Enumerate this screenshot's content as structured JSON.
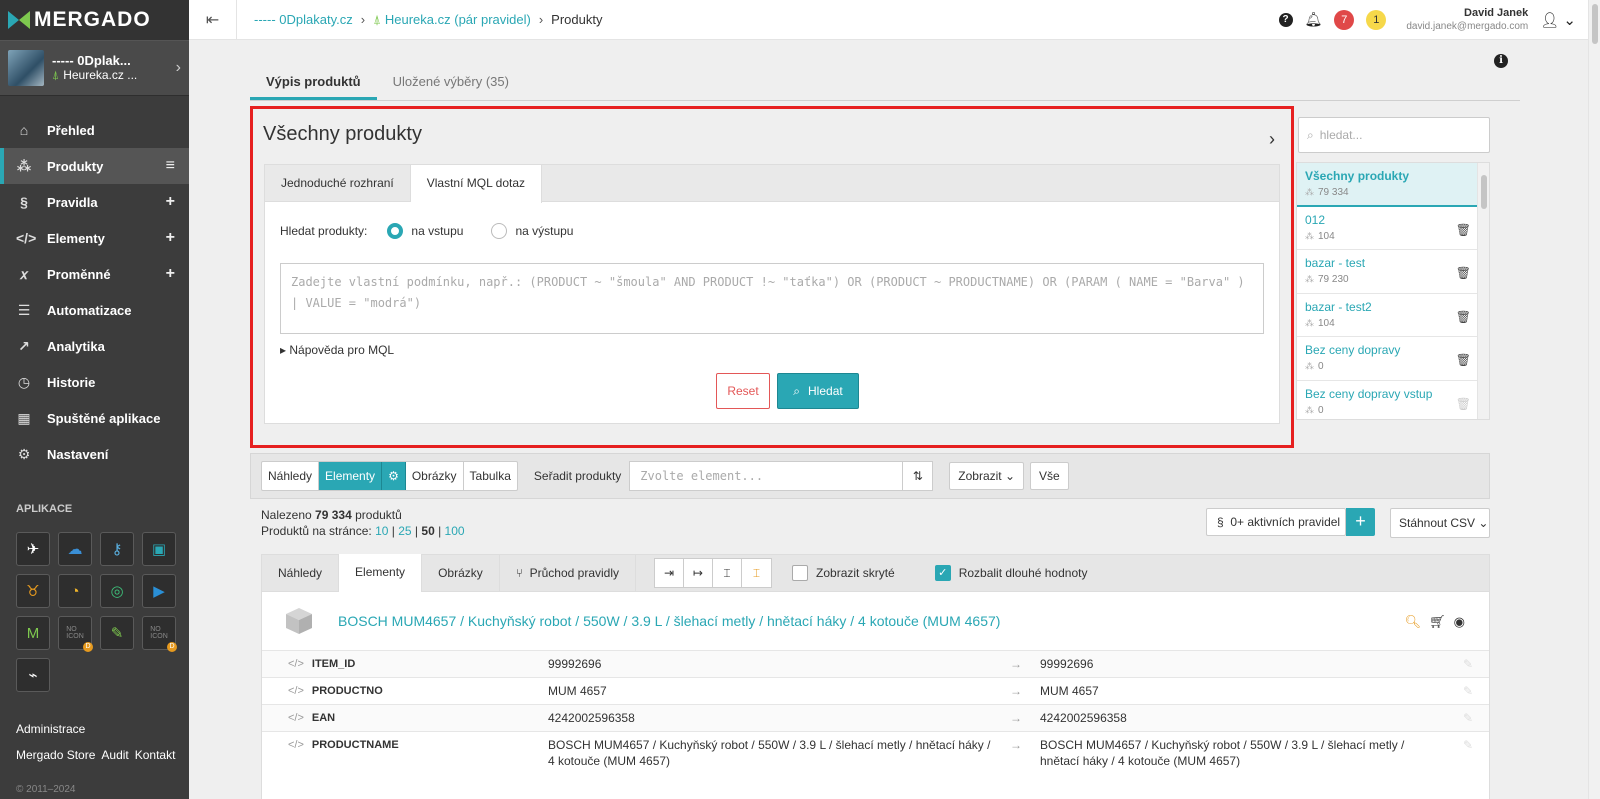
{
  "sidebar": {
    "logo": "MERGADO",
    "shop": {
      "name": "----- 0Dplak...",
      "sub": "Heureka.cz ..."
    },
    "nav": [
      {
        "label": "Přehled",
        "icon": "home-icon"
      },
      {
        "label": "Produkty",
        "icon": "products-icon",
        "extra": "≡"
      },
      {
        "label": "Pravidla",
        "icon": "section-icon",
        "extra": "+"
      },
      {
        "label": "Elementy",
        "icon": "code-icon",
        "extra": "+"
      },
      {
        "label": "Proměnné",
        "icon": "variable-icon",
        "extra": "+"
      },
      {
        "label": "Automatizace",
        "icon": "automation-icon"
      },
      {
        "label": "Analytika",
        "icon": "chart-icon"
      },
      {
        "label": "Historie",
        "icon": "clock-icon"
      },
      {
        "label": "Spuštěné aplikace",
        "icon": "apps-icon"
      },
      {
        "label": "Nastavení",
        "icon": "gear-icon"
      }
    ],
    "apps_title": "APLIKACE",
    "footer": {
      "admin": "Administrace",
      "store": "Mergado Store",
      "audit": "Audit",
      "contact": "Kontakt"
    },
    "copyright": "© 2011–2024"
  },
  "topbar": {
    "breadcrumb": [
      "----- 0Dplakaty.cz",
      "Heureka.cz (pár pravidel)",
      "Produkty"
    ],
    "notifications_count": "7",
    "warnings_count": "1",
    "user_name": "David Janek",
    "user_email": "david.janek@mergado.com"
  },
  "main": {
    "tabs": [
      "Výpis produktů",
      "Uložené výběry (35)"
    ],
    "panel_title": "Všechny produkty",
    "inner_tabs": [
      "Jednoduché rozhraní",
      "Vlastní MQL dotaz"
    ],
    "search_label": "Hledat produkty:",
    "radio_input": "na vstupu",
    "radio_output": "na výstupu",
    "mql_placeholder": "Zadejte vlastní podmínku, např.: (PRODUCT ~ \"šmoula\" AND PRODUCT !~ \"taťka\") OR (PRODUCT ~ PRODUCTNAME) OR (PARAM ( NAME = \"Barva\" ) | VALUE = \"modrá\")",
    "mql_help": "Nápověda pro MQL",
    "reset": "Reset",
    "search": "Hledat"
  },
  "saved": {
    "placeholder": "hledat...",
    "items": [
      {
        "name": "Všechny produkty",
        "count": "79 334"
      },
      {
        "name": "012",
        "count": "104"
      },
      {
        "name": "bazar - test",
        "count": "79 230"
      },
      {
        "name": "bazar - test2",
        "count": "104"
      },
      {
        "name": "Bez ceny dopravy",
        "count": "0"
      },
      {
        "name": "Bez ceny dopravy vstup",
        "count": "0"
      }
    ]
  },
  "toolbar": {
    "views": [
      "Náhledy",
      "Elementy",
      "⚙",
      "Obrázky",
      "Tabulka"
    ],
    "sort_label": "Seřadit produkty",
    "sort_placeholder": "Zvolte element...",
    "show": "Zobrazit",
    "all": "Vše"
  },
  "results": {
    "found_prefix": "Nalezeno",
    "found_count": "79 334",
    "found_suffix": "produktů",
    "per_page_label": "Produktů na stránce:",
    "per_page": [
      "10",
      "25",
      "50",
      "100"
    ],
    "rules": "0+ aktivních pravidel",
    "csv": "Stáhnout CSV"
  },
  "card": {
    "tabs": [
      "Náhledy",
      "Elementy",
      "Obrázky",
      "Průchod pravidly"
    ],
    "show_hidden": "Zobrazit skryté",
    "expand_long": "Rozbalit dlouhé hodnoty",
    "title": "BOSCH MUM4657 / Kuchyňský robot / 550W / 3.9 L / šlehací metly / hnětací háky / 4 kotouče (MUM 4657)",
    "rows": [
      {
        "key": "ITEM_ID",
        "in": "99992696",
        "out": "99992696"
      },
      {
        "key": "PRODUCTNO",
        "in": "MUM 4657",
        "out": "MUM 4657"
      },
      {
        "key": "EAN",
        "in": "4242002596358",
        "out": "4242002596358"
      },
      {
        "key": "PRODUCTNAME",
        "in": "BOSCH MUM4657 / Kuchyňský robot / 550W / 3.9 L / šlehací metly / hnětací háky / 4 kotouče (MUM 4657)",
        "out": "BOSCH MUM4657 / Kuchyňský robot / 550W / 3.9 L / šlehací metly / hnětací háky / 4 kotouče (MUM 4657)"
      }
    ]
  },
  "colors": {
    "accent": "#2aa7b4",
    "highlight": "#e62020",
    "sidebar": "#3c3c3c"
  }
}
